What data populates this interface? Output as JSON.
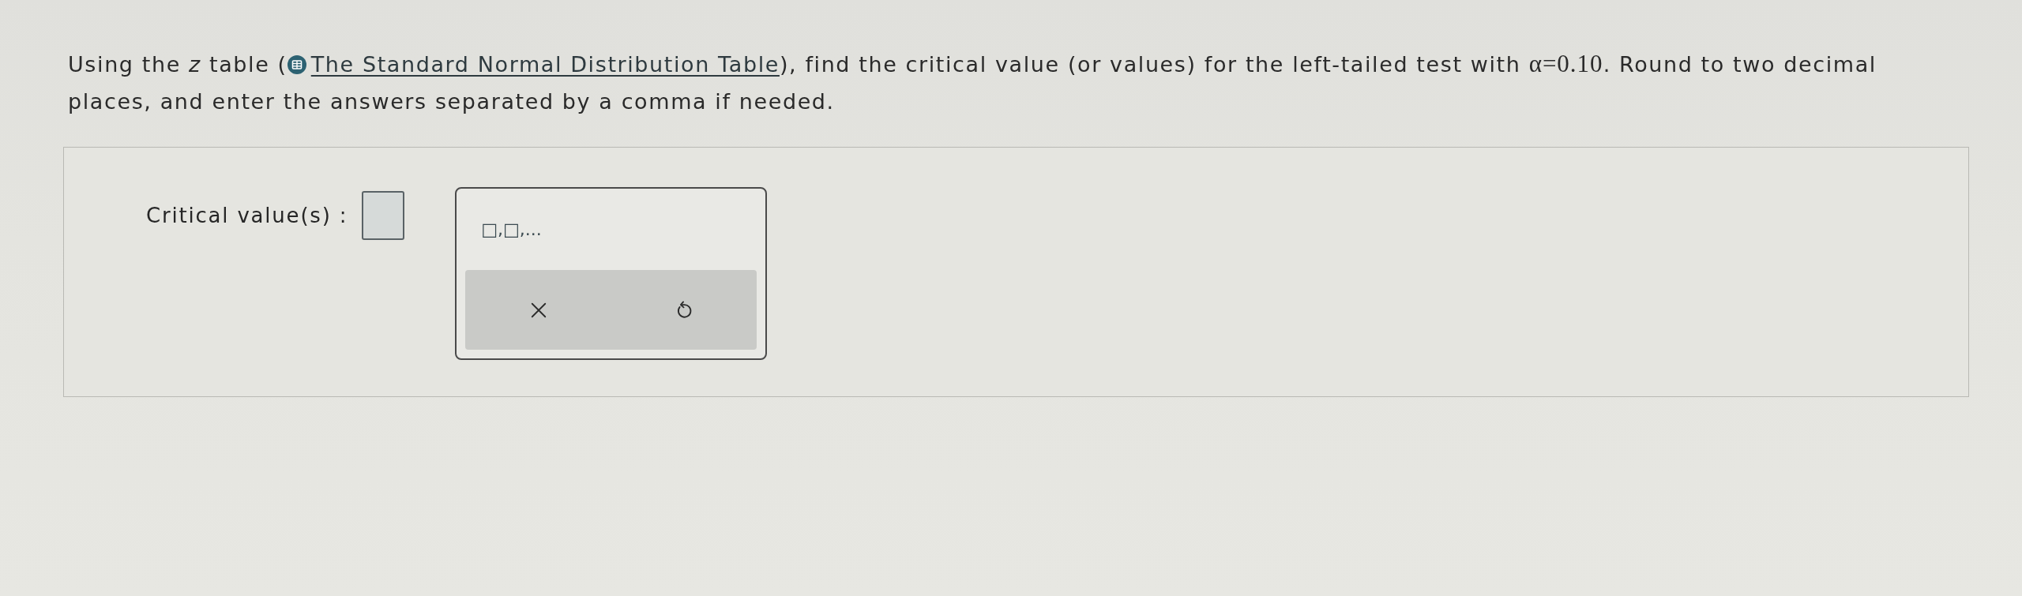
{
  "question": {
    "intro": "Using the *z* table (",
    "link": {
      "label": "The Standard Normal Distribution Table"
    },
    "middle": "), find the critical value (or values) for the left-tailed test with ",
    "math": "α=0.10",
    "ending": ". Round to two decimal places, and enter the answers separated by a comma if needed."
  },
  "answer": {
    "label": "Critical value(s) :"
  },
  "keypad": {
    "template": "□,□,...",
    "buttons": [
      {
        "kind": "clear"
      },
      {
        "kind": "undo"
      }
    ]
  }
}
